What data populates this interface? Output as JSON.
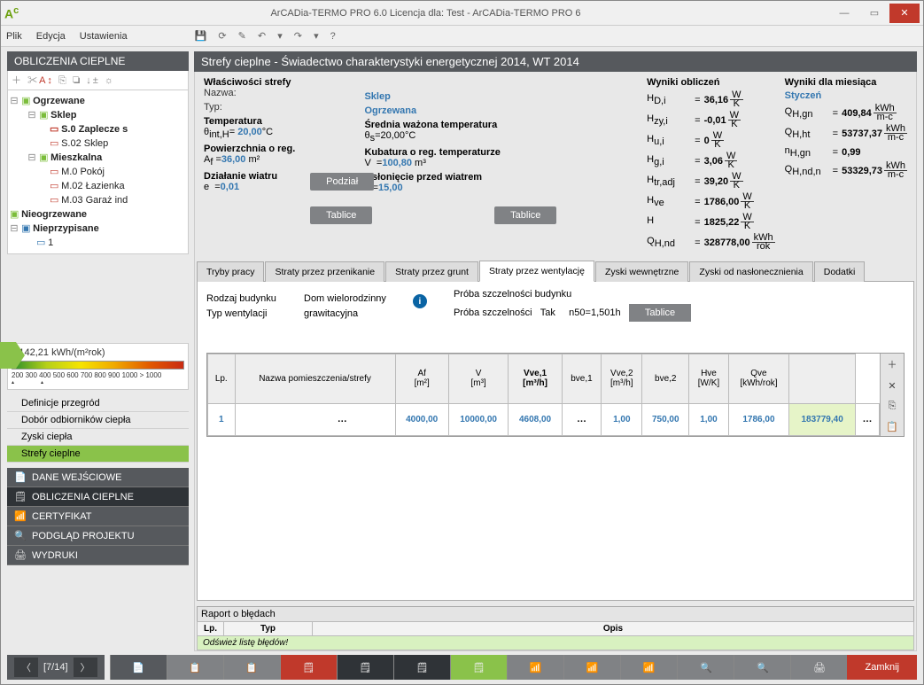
{
  "titlebar": {
    "title": "ArCADia-TERMO PRO 6.0 Licencja dla: Test - ArCADia-TERMO PRO 6"
  },
  "menu": {
    "file": "Plik",
    "edit": "Edycja",
    "settings": "Ustawienia"
  },
  "sidebar": {
    "header": "OBLICZENIA CIEPLNE"
  },
  "tree": {
    "ogrzewane": "Ogrzewane",
    "sklep": "Sklep",
    "zaplecze": "S.0 Zaplecze s",
    "s02": "S.02 Sklep",
    "mieszkalna": "Mieszkalna",
    "m0": "M.0 Pokój",
    "m02": "M.02 Łazienka",
    "m03": "M.03 Garaż ind",
    "nieogrzewane": "Nieogrzewane",
    "nieprzypisane": "Nieprzypisane",
    "one": "1"
  },
  "energy": {
    "value": "142,21 kWh/(m²rok)",
    "ticks": " 200  300   400   500   600   700   800   900  1000  > 1000"
  },
  "navlist": {
    "def": "Definicje przegród",
    "dobor": "Dobór odbiorników ciepła",
    "zyski": "Zyski ciepła",
    "strefy": "Strefy cieplne"
  },
  "bignav": {
    "dane": "DANE WEJŚCIOWE",
    "oblicz": "OBLICZENIA CIEPLNE",
    "cert": "CERTYFIKAT",
    "podglad": "PODGLĄD PROJEKTU",
    "wydruki": "WYDRUKI"
  },
  "main": {
    "title": "Strefy cieplne - Świadectwo charakterystyki energetycznej 2014, WT 2014"
  },
  "zone": {
    "props": "Właściwości strefy",
    "nazwa_l": "Nazwa:",
    "nazwa": "Sklep",
    "typ_l": "Typ:",
    "typ": "Ogrzewana",
    "temp_h": "Temperatura",
    "temp_sym": "θ",
    "temp_sub": "int,H",
    "temp_v": "20,00",
    "temp_u": "°C",
    "pow_h": "Powierzchnia o reg.",
    "pow_sym": "A",
    "pow_sub": "f",
    "pow_v": "36,00",
    "pow_u": " m²",
    "dzial_h": "Działanie wiatru",
    "dzial_sym": "e",
    "dzial_v": "0,01",
    "sred_h": "Średnia ważona temperatura",
    "sred_sym": "θ",
    "sred_sub": "s",
    "sred_v": "20,00",
    "sred_u": "°C",
    "kub_h": "Kubatura o reg. temperaturze",
    "kub_sym": "V",
    "kub_v": "100,80",
    "kub_u": " m³",
    "osl_h": "Osłonięcie przed wiatrem",
    "osl_sym": "f",
    "osl_v": "15,00",
    "podzial": "Podział",
    "tablice": "Tablice"
  },
  "results": {
    "header": "Wyniki obliczeń",
    "monthly": "Wyniki dla miesiąca",
    "month": "Styczeń",
    "rows": [
      {
        "k": "H",
        "sub": "D,i",
        "v": "36,16",
        "ut": "W",
        "ub": "K"
      },
      {
        "k": "H",
        "sub": "zy,i",
        "v": "-0,01",
        "ut": "W",
        "ub": "K"
      },
      {
        "k": "H",
        "sub": "u,i",
        "v": "0",
        "ut": "W",
        "ub": "K"
      },
      {
        "k": "H",
        "sub": "g,i",
        "v": "3,06",
        "ut": "W",
        "ub": "K"
      },
      {
        "k": "H",
        "sub": "tr,adj",
        "v": "39,20",
        "ut": "W",
        "ub": "K"
      },
      {
        "k": "H",
        "sub": "ve",
        "v": "1786,00",
        "ut": "W",
        "ub": "K"
      },
      {
        "k": "H",
        "sub": "",
        "v": "1825,22",
        "ut": "W",
        "ub": "K"
      },
      {
        "k": "Q",
        "sub": "H,nd",
        "v": "328778,00",
        "ut": "kWh",
        "ub": "rok"
      }
    ],
    "mrows": [
      {
        "k": "Q",
        "sub": "H,gn",
        "v": "409,84",
        "ut": "kWh",
        "ub": "m-c"
      },
      {
        "k": "Q",
        "sub": "H,ht",
        "v": "53737,37",
        "ut": "kWh",
        "ub": "m-c"
      },
      {
        "k": "n",
        "sub": "H,gn",
        "v": "0,99",
        "ut": "",
        "ub": ""
      },
      {
        "k": "Q",
        "sub": "H,nd,n",
        "v": "53329,73",
        "ut": "kWh",
        "ub": "m-c"
      }
    ]
  },
  "tabs": [
    "Tryby pracy",
    "Straty przez przenikanie",
    "Straty przez grunt",
    "Straty przez wentylację",
    "Zyski wewnętrzne",
    "Zyski od nasłonecznienia",
    "Dodatki"
  ],
  "vent": {
    "rodzaj_l": "Rodzaj budynku",
    "rodzaj": "Dom wielorodzinny",
    "typw_l": "Typ wentylacji",
    "typw": "grawitacyjna",
    "proba_h": "Próba szczelności budynku",
    "proba_l": "Próba szczelności",
    "proba": "Tak",
    "n50": "1,50",
    "n50_u": "1\nh",
    "tablice": "Tablice"
  },
  "table": {
    "hdr": [
      "Lp.",
      "Nazwa pomieszczenia/strefy",
      "Af\n[m²]",
      "V\n[m³]",
      "Vve,1\n[m³/h]",
      "bve,1",
      "Vve,2\n[m³/h]",
      "bve,2",
      "Hve\n[W/K]",
      "Qve\n[kWh/rok]"
    ],
    "row": {
      "lp": "1",
      "af": "4000,00",
      "v": "10000,00",
      "vve1": "4608,00",
      "bve1": "1,00",
      "vve2": "750,00",
      "bve2": "1,00",
      "hve": "1786,00",
      "qve": "183779,40"
    }
  },
  "err": {
    "title": "Raport o błędach",
    "lp": "Lp.",
    "typ": "Typ",
    "opis": "Opis",
    "msg": "Odśwież listę błędów!"
  },
  "pager": "[7/14]",
  "close": "Zamknij"
}
